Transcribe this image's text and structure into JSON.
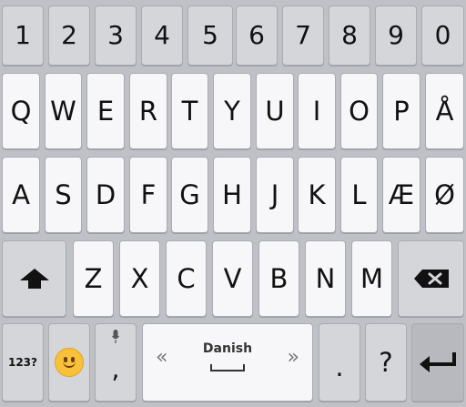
{
  "keyboard": {
    "number_row": [
      "1",
      "2",
      "3",
      "4",
      "5",
      "6",
      "7",
      "8",
      "9",
      "0"
    ],
    "row1": [
      "Q",
      "W",
      "E",
      "R",
      "T",
      "Y",
      "U",
      "I",
      "O",
      "P",
      "Å"
    ],
    "row2": [
      "A",
      "S",
      "D",
      "F",
      "G",
      "H",
      "J",
      "K",
      "L",
      "Æ",
      "Ø"
    ],
    "row3": [
      "Z",
      "X",
      "C",
      "V",
      "B",
      "N",
      "M"
    ],
    "symbols_label": "123?",
    "comma_label": ",",
    "language_label": "Danish",
    "period_label": ".",
    "question_label": "?",
    "icons": {
      "shift": "shift-icon",
      "backspace": "backspace-icon",
      "emoji": "emoji-icon",
      "mic": "mic-icon",
      "enter": "enter-icon",
      "prev_lang": "chevron-left-icon",
      "next_lang": "chevron-right-icon"
    }
  }
}
